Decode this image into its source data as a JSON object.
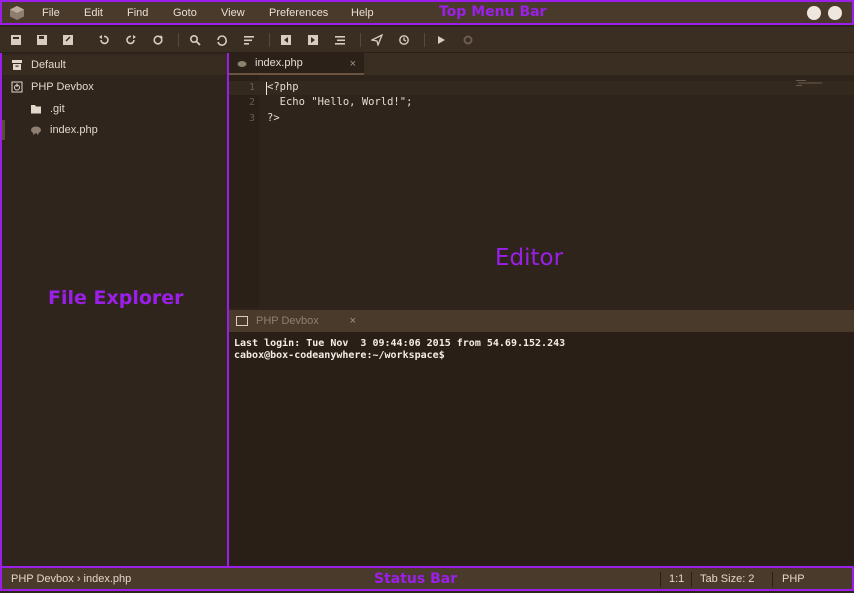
{
  "menubar": {
    "items": [
      {
        "label": "File"
      },
      {
        "label": "Edit"
      },
      {
        "label": "Find"
      },
      {
        "label": "Goto"
      },
      {
        "label": "View"
      },
      {
        "label": "Preferences"
      },
      {
        "label": "Help"
      }
    ],
    "annotation": "Top Menu Bar",
    "right_icons": [
      "notifications-icon",
      "user-icon"
    ]
  },
  "toolbar": {
    "buttons": [
      "new-file-icon",
      "save-icon",
      "save-all-icon",
      "undo-icon",
      "redo-icon",
      "refresh-icon",
      "search-icon",
      "replace-icon",
      "wrap-icon",
      "indent-left-icon",
      "indent-right-icon",
      "format-icon",
      "deploy-icon",
      "history-icon",
      "run-icon",
      "settings-icon"
    ]
  },
  "explorer": {
    "annotation": "File Explorer",
    "items": [
      {
        "label": "Default",
        "icon": "archive-icon"
      },
      {
        "label": "PHP Devbox",
        "icon": "power-icon"
      },
      {
        "label": ".git",
        "icon": "folder-icon"
      },
      {
        "label": "index.php",
        "icon": "php-elephant-icon"
      }
    ]
  },
  "editor": {
    "annotation": "Editor",
    "tab": {
      "label": "index.php",
      "close": "×"
    },
    "lines": [
      {
        "num": "1",
        "text": "<?php"
      },
      {
        "num": "2",
        "text": "  Echo \"Hello, World!\";"
      },
      {
        "num": "3",
        "text": "?>"
      }
    ]
  },
  "terminal": {
    "tab": {
      "label": "PHP Devbox",
      "close": "×"
    },
    "lines": [
      "Last login: Tue Nov  3 09:44:06 2015 from 54.69.152.243",
      "cabox@box-codeanywhere:~/workspace$"
    ]
  },
  "statusbar": {
    "breadcrumb": "PHP Devbox › index.php",
    "annotation": "Status Bar",
    "cursor": "1:1",
    "tab_size": "Tab Size: 2",
    "language": "PHP"
  },
  "colors": {
    "annotation_purple": "#9b1fe8",
    "chrome_brown": "#4a3a2c",
    "editor_bg": "#2e241b"
  }
}
